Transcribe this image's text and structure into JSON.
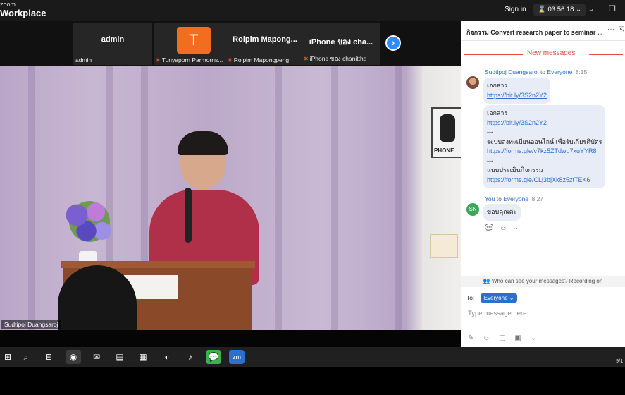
{
  "app": {
    "brand_top": "zoom",
    "brand_main": "Workplace",
    "sign_in": "Sign in",
    "timer": "03:56:18",
    "minimize_icon": "⌄",
    "restore_icon": "❐"
  },
  "participants": [
    {
      "big_label": "admin",
      "name": "admin",
      "muted": false
    },
    {
      "avatar_letter": "T",
      "name": "Tunyaporn Parmorns...",
      "muted": true
    },
    {
      "big_label": "Roipim  Mapong...",
      "name": "Roipim Mapongpeng",
      "muted": true
    },
    {
      "big_label": "iPhone ของ cha...",
      "name": "iPhone ของ chanittha",
      "muted": true
    }
  ],
  "next_icon": "›",
  "mute_icon": "✖",
  "main_video": {
    "speaker_name": "Sudtipoj Duangsaroj",
    "phone_sign": "PHONE"
  },
  "chat": {
    "title": "กิจกรรม Convert research paper to seminar ...",
    "more_icon": "···",
    "popout_icon": "⇱",
    "new_messages": "New messages",
    "msg1": {
      "sender": "Sudtipoj Duangsaroj",
      "to_word": "to",
      "recipient": "Everyone",
      "time": "8:15",
      "bubble1_line1": "เอกสาร",
      "bubble1_link": "https://bit.ly/3S2n2Y2",
      "bubble2_line1": "เอกสาร",
      "bubble2_link1": "https://bit.ly/3S2n2Y2",
      "sep1": "---",
      "bubble2_line2": "ระบบลงทะเบียนออนไลน์ เพื่อรับเกียรติบัตร",
      "bubble2_link2": "https://forms.gle/v7kz5ZTdwu7xuYYR8",
      "sep2": "---",
      "bubble2_line3": "แบบประเมินกิจกรรม",
      "bubble2_link3": "https://forms.gle/CLj3bjXk8z5ztTEK6"
    },
    "msg2": {
      "sender": "You",
      "to_word": "to",
      "recipient": "Everyone",
      "time": "8:27",
      "avatar": "SN",
      "text": "ขอบคุณค่ะ"
    },
    "reactions": [
      "💬",
      "☺",
      "···"
    ],
    "who_can_see": "Who can see your messages? Recording on",
    "to_label": "To:",
    "to_value": "Everyone",
    "input_placeholder": "Type message here...",
    "tool_icons": [
      "✎",
      "☺",
      "▢",
      "▣",
      "⌄"
    ]
  },
  "taskbar": {
    "icons": [
      "⊞",
      "⌕",
      "⊟",
      "◉",
      "✉",
      "▤",
      "▦",
      "◐",
      "♪",
      "💬",
      "zm"
    ],
    "clock": "9/1"
  }
}
